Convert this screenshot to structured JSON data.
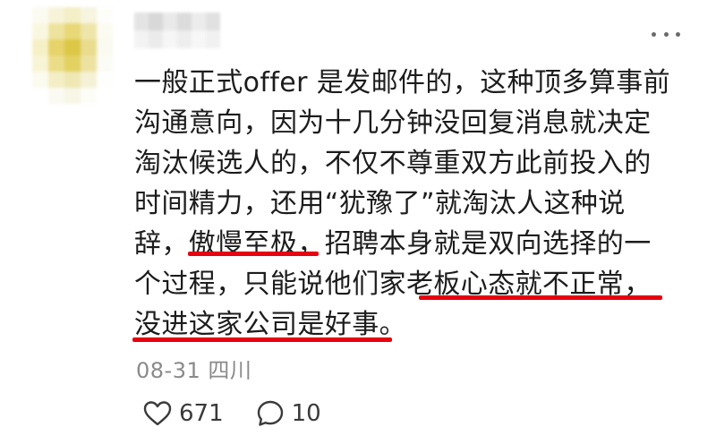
{
  "post": {
    "lines": [
      "一般正式offer 是发邮件的，这种顶多算事前",
      "沟通意向，因为十几分钟没回复消息就决定",
      "淘汰候选人的，不仅不尊重双方此前投入的",
      "时间精力，还用“犹豫了”就淘汰人这种说",
      "辞，傲慢至极，招聘本身就是双向选择的一",
      "个过程，只能说他们家老板心态就不正常，",
      "没进这家公司是好事。"
    ],
    "highlight_color": "#e60012"
  },
  "meta": {
    "date": "08-31",
    "location": "四川"
  },
  "actions": {
    "like_icon": "heart-icon",
    "like_count": "671",
    "comment_icon": "comment-bubble-icon",
    "comment_count": "10"
  },
  "more_icon": "more-dots-icon"
}
